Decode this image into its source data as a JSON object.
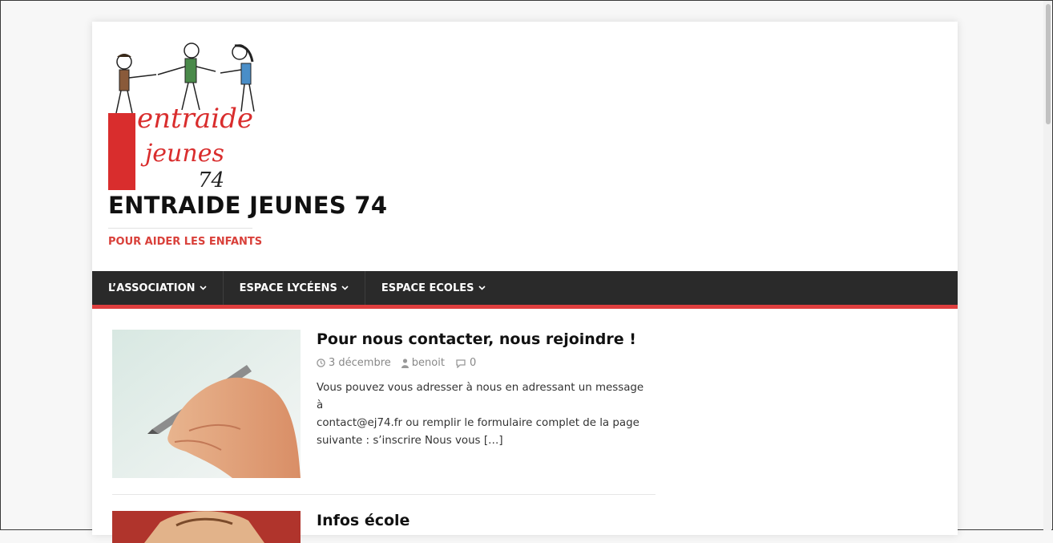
{
  "site": {
    "title": "ENTRAIDE JEUNES 74",
    "tagline": "POUR AIDER LES ENFANTS",
    "logo_lines": [
      "entraide",
      "jeunes",
      "74"
    ]
  },
  "nav": {
    "items": [
      {
        "label": "L’ASSOCIATION"
      },
      {
        "label": "ESPACE LYCÉENS"
      },
      {
        "label": "ESPACE ECOLES"
      }
    ]
  },
  "posts": [
    {
      "title": "Pour nous contacter, nous rejoindre !",
      "date": "3 décembre",
      "author": "benoit",
      "comments": "0",
      "excerpt_lines": [
        "Vous pouvez vous adresser à nous en adressant un message à",
        "contact@ej74.fr ou remplir le formulaire complet de la page",
        "suivante : s’inscrire Nous vous"
      ],
      "more": "[…]"
    },
    {
      "title": "Infos école"
    }
  ],
  "colors": {
    "accent": "#df3e3e",
    "nav_bg": "#2a2a2a",
    "tagline": "#d9403a"
  },
  "icons": {
    "date": "clock-icon",
    "author": "user-icon",
    "comments": "comment-icon",
    "nav_dropdown": "chevron-down-icon"
  }
}
